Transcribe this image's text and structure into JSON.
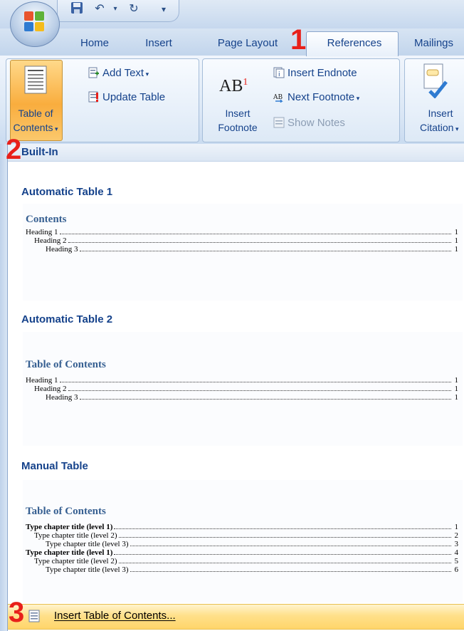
{
  "quick_access": {
    "undo_glyph": "↶",
    "redo_glyph": "↻",
    "dropdown_glyph": "▾"
  },
  "tabs": [
    {
      "label": "Home"
    },
    {
      "label": "Insert"
    },
    {
      "label": "Page Layout"
    },
    {
      "label": "References"
    },
    {
      "label": "Mailings"
    }
  ],
  "steps": [
    "1",
    "2",
    "3"
  ],
  "ribbon": {
    "toc_button_line1": "Table of",
    "toc_button_line2": "Contents",
    "add_text": "Add Text",
    "update_table": "Update Table",
    "ab_glyph": "AB",
    "ab_sup": "1",
    "insert_footnote_line1": "Insert",
    "insert_footnote_line2": "Footnote",
    "insert_endnote": "Insert Endnote",
    "next_footnote": "Next Footnote",
    "show_notes": "Show Notes",
    "insert_citation_line1": "Insert",
    "insert_citation_line2": "Citation"
  },
  "gallery": {
    "builtin_header": "Built-In",
    "auto1": {
      "title": "Automatic Table 1",
      "heading": "Contents",
      "lines": [
        {
          "text": "Heading 1",
          "page": "1"
        },
        {
          "text": "Heading 2",
          "page": "1"
        },
        {
          "text": "Heading 3",
          "page": "1"
        }
      ]
    },
    "auto2": {
      "title": "Automatic Table 2",
      "heading": "Table of Contents",
      "lines": [
        {
          "text": "Heading 1",
          "page": "1"
        },
        {
          "text": "Heading 2",
          "page": "1"
        },
        {
          "text": "Heading 3",
          "page": "1"
        }
      ]
    },
    "manual": {
      "title": "Manual Table",
      "heading": "Table of Contents",
      "lines": [
        {
          "text": "Type chapter title (level 1)",
          "page": "1"
        },
        {
          "text": "Type chapter title (level 2)",
          "page": "2"
        },
        {
          "text": "Type chapter title (level 3)",
          "page": "3"
        },
        {
          "text": "Type chapter title (level 1)",
          "page": "4"
        },
        {
          "text": "Type chapter title (level 2)",
          "page": "5"
        },
        {
          "text": "Type chapter title (level 3)",
          "page": "6"
        }
      ]
    },
    "insert_toc_label": "Insert Table of Contents..."
  },
  "colors": {
    "accent_orange": "#f9ad3e",
    "ribbon_text": "#15428b",
    "step_red": "#e8201a",
    "heading_blue": "#365f91"
  }
}
